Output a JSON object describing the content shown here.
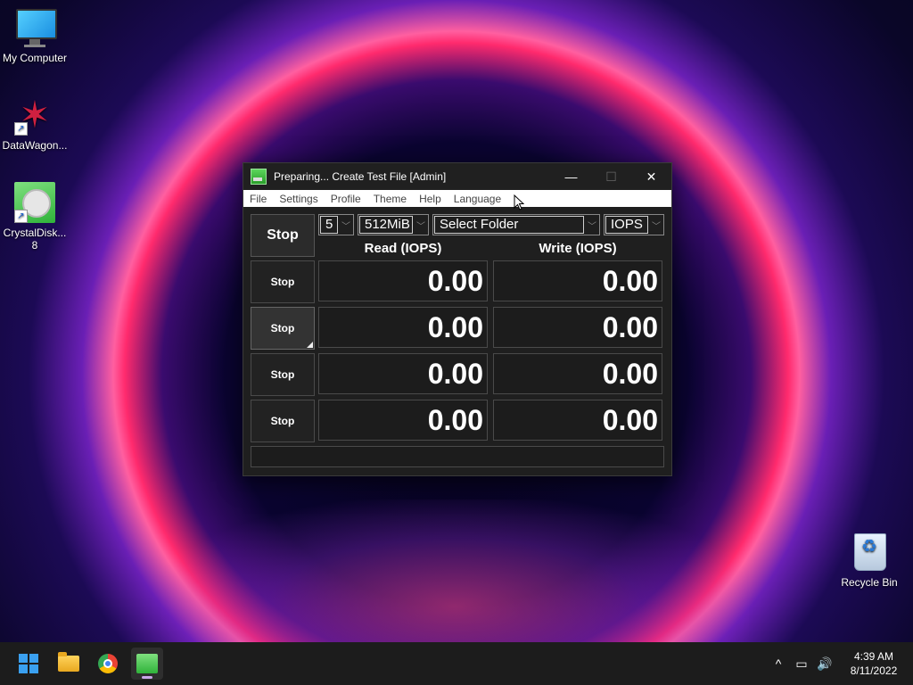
{
  "desktop": {
    "icons": [
      {
        "label": "My Computer",
        "icon": "monitor-icon"
      },
      {
        "label": "DataWagon...",
        "icon": "datawagon-icon"
      },
      {
        "label": "CrystalDisk... 8",
        "icon": "crystaldiskmark-icon"
      },
      {
        "label": "Recycle Bin",
        "icon": "recycle-bin-icon"
      }
    ]
  },
  "window": {
    "title": "Preparing... Create Test File [Admin]",
    "controls": {
      "minimize": "—",
      "maximize": "☐",
      "close": "✕"
    },
    "menu": [
      "File",
      "Settings",
      "Profile",
      "Theme",
      "Help",
      "Language"
    ],
    "main_button": "Stop",
    "combos": {
      "count": "5",
      "size": "512MiB",
      "folder": "Select Folder",
      "unit": "IOPS"
    },
    "headers": {
      "read": "Read (IOPS)",
      "write": "Write (IOPS)"
    },
    "rows": [
      {
        "button": "Stop",
        "read": "0.00",
        "write": "0.00"
      },
      {
        "button": "Stop",
        "read": "0.00",
        "write": "0.00"
      },
      {
        "button": "Stop",
        "read": "0.00",
        "write": "0.00"
      },
      {
        "button": "Stop",
        "read": "0.00",
        "write": "0.00"
      }
    ],
    "status": ""
  },
  "taskbar": {
    "apps": [
      "start-icon",
      "file-explorer-icon",
      "chrome-icon",
      "crystaldiskmark-icon"
    ],
    "tray": {
      "chevron": "^",
      "network": "▭",
      "volume": "🔊"
    },
    "time": "4:39 AM",
    "date": "8/11/2022"
  }
}
